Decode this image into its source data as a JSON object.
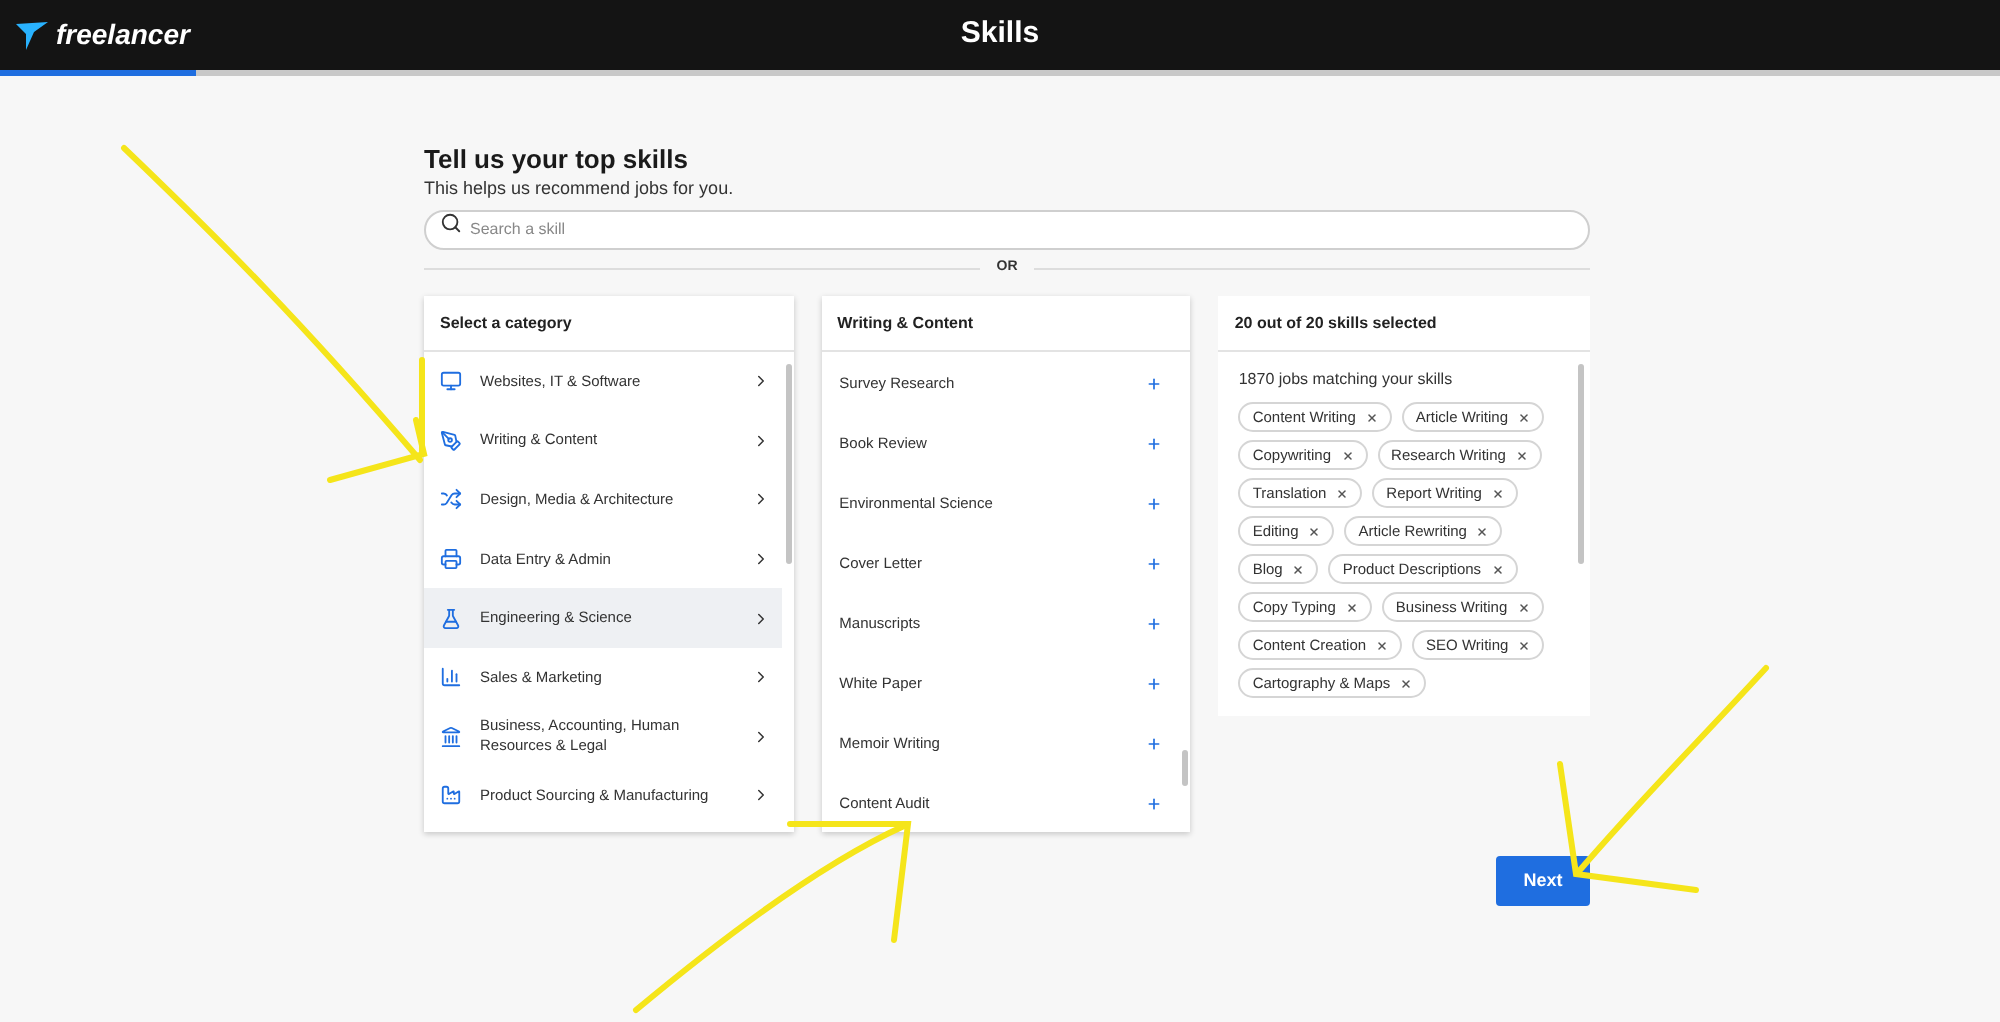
{
  "header": {
    "logo": "freelancer",
    "title": "Skills",
    "progress": {
      "level": 0.098
    }
  },
  "intro": {
    "title": "Tell us your top skills",
    "subtitle": "This helps us recommend jobs for you."
  },
  "search": {
    "placeholder": "Search a skill"
  },
  "divider_label": "OR",
  "categories": {
    "title": "Select a category",
    "items": [
      {
        "label": "Websites, IT & Software",
        "highlighted": false
      },
      {
        "label": "Writing & Content",
        "highlighted": false
      },
      {
        "label": "Design, Media & Architecture",
        "highlighted": false
      },
      {
        "label": "Data Entry & Admin",
        "highlighted": false
      },
      {
        "label": "Engineering & Science",
        "highlighted": true
      },
      {
        "label": "Sales & Marketing",
        "highlighted": false
      },
      {
        "label": "Business, Accounting, Human Resources & Legal",
        "highlighted": false
      },
      {
        "label": "Product Sourcing & Manufacturing",
        "highlighted": false
      }
    ]
  },
  "skills": {
    "title": "Writing & Content",
    "items": [
      "Survey Research",
      "Book Review",
      "Environmental Science",
      "Cover Letter",
      "Manuscripts",
      "White Paper",
      "Memoir Writing",
      "Content Audit"
    ]
  },
  "selected": {
    "title": "20 out of 20 skills selected",
    "jobs": "1870 jobs matching your skills",
    "tags": [
      "Content Writing",
      "Article Writing",
      "Copywriting",
      "Research Writing",
      "Translation",
      "Report Writing",
      "Editing",
      "Article Rewriting",
      "Blog",
      "Product Descriptions",
      "Copy Typing",
      "Business Writing",
      "Content Creation",
      "SEO Writing",
      "Cartography & Maps"
    ]
  },
  "next_button": "Next"
}
